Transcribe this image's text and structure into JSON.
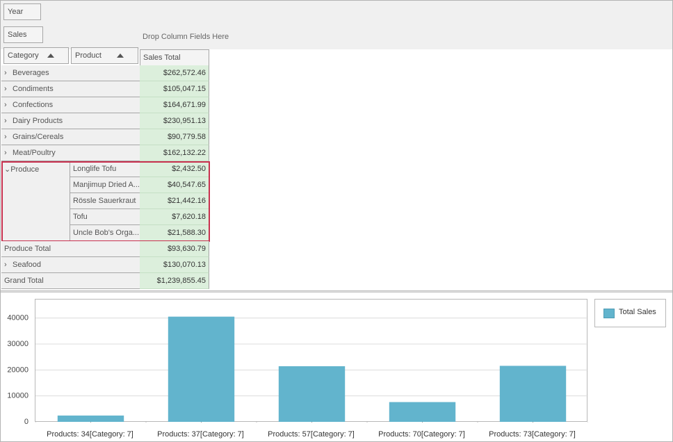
{
  "filter_fields": {
    "year": "Year",
    "sales": "Sales"
  },
  "drop_hint": "Drop Column Fields Here",
  "row_fields": {
    "category": "Category",
    "product": "Product"
  },
  "data_header": "Sales Total",
  "categories": [
    {
      "label": "Beverages",
      "value": "$262,572.46"
    },
    {
      "label": "Condiments",
      "value": "$105,047.15"
    },
    {
      "label": "Confections",
      "value": "$164,671.99"
    },
    {
      "label": "Dairy Products",
      "value": "$230,951.13"
    },
    {
      "label": "Grains/Cereals",
      "value": "$90,779.58"
    },
    {
      "label": "Meat/Poultry",
      "value": "$162,132.22"
    }
  ],
  "produce": {
    "label": "Produce",
    "products": [
      {
        "label": "Longlife Tofu",
        "value": "$2,432.50"
      },
      {
        "label": "Manjimup Dried A...",
        "value": "$40,547.65"
      },
      {
        "label": "Rössle Sauerkraut",
        "value": "$21,442.16"
      },
      {
        "label": "Tofu",
        "value": "$7,620.18"
      },
      {
        "label": "Uncle Bob's Orga...",
        "value": "$21,588.30"
      }
    ],
    "total_label": "Produce Total",
    "total_value": "$93,630.79"
  },
  "seafood": {
    "label": "Seafood",
    "value": "$130,070.13"
  },
  "grand_total": {
    "label": "Grand Total",
    "value": "$1,239,855.45"
  },
  "chevron_collapsed": "›",
  "chevron_expanded": "⌄",
  "colors": {
    "bar": "#62b4cd",
    "highlight": "#c8304e",
    "value_cell": "#dcefdc"
  },
  "chart_data": {
    "type": "bar",
    "categories": [
      "Products: 34[Category: 7]",
      "Products: 37[Category: 7]",
      "Products: 57[Category: 7]",
      "Products: 70[Category: 7]",
      "Products: 73[Category: 7]"
    ],
    "series": [
      {
        "name": "Total Sales",
        "values": [
          2432.5,
          40547.65,
          21442.16,
          7620.18,
          21588.3
        ]
      }
    ],
    "y_ticks": [
      "0",
      "10000",
      "20000",
      "30000",
      "40000"
    ],
    "ylim": [
      0,
      45000
    ],
    "grid": true,
    "legend": "right"
  }
}
